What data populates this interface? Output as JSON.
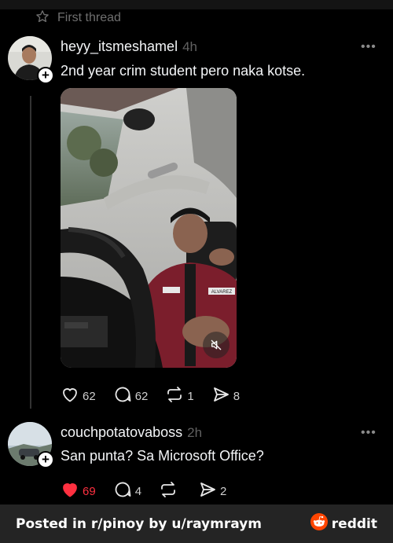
{
  "thread_header": {
    "label": "First thread",
    "icon": "star-icon"
  },
  "posts": [
    {
      "username": "heyy_itsmeshamel",
      "time": "4h",
      "text": "2nd year crim student pero naka kotse.",
      "more_label": "•••",
      "media": {
        "type": "video",
        "muted": true,
        "uniform_text": "ALVAREZ"
      },
      "actions": {
        "likes": "62",
        "comments": "62",
        "reposts": "1",
        "shares": "8",
        "liked": false
      }
    },
    {
      "username": "couchpotatovaboss",
      "time": "2h",
      "text": "San punta? Sa Microsoft Office?",
      "more_label": "•••",
      "actions": {
        "likes": "69",
        "comments": "4",
        "reposts": "",
        "shares": "2",
        "liked": true
      }
    }
  ],
  "footer": {
    "credit": "Posted in r/pinoy by u/raymraym",
    "brand": "reddit"
  },
  "colors": {
    "like_active": "#ff3040",
    "background": "#000000",
    "footer_bg": "#242424",
    "reddit_orange": "#ff4500"
  }
}
